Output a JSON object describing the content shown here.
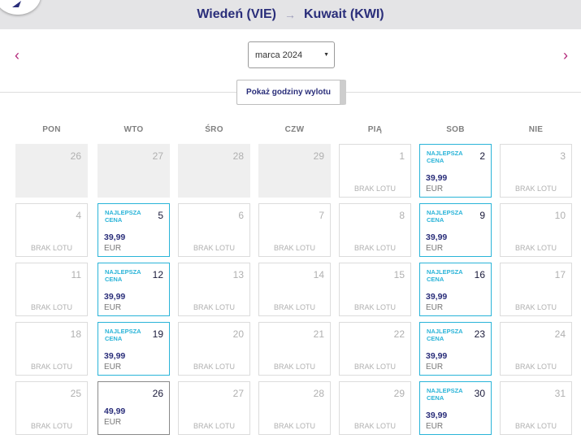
{
  "header": {
    "origin": "Wiedeń (VIE)",
    "arrow": "→",
    "destination": "Kuwait (KWI)"
  },
  "nav": {
    "prev_icon": "‹",
    "next_icon": "›"
  },
  "month_select": {
    "value": "marca 2024"
  },
  "show_times_button": "Pokaż godziny wylotu",
  "colors": {
    "brand": "#2a2e7a",
    "accent": "#b3287a",
    "best": "#2ab4d8"
  },
  "calendar": {
    "weekdays": [
      "PON",
      "WTO",
      "ŚRO",
      "CZW",
      "PIĄ",
      "SOB",
      "NIE"
    ],
    "no_flight_label": "BRAK LOTU",
    "best_label": "NAJLEPSZA CENA",
    "currency": "EUR",
    "days": [
      {
        "day": "26",
        "state": "disabled"
      },
      {
        "day": "27",
        "state": "disabled"
      },
      {
        "day": "28",
        "state": "disabled"
      },
      {
        "day": "29",
        "state": "disabled"
      },
      {
        "day": "1",
        "state": "none"
      },
      {
        "day": "2",
        "state": "best",
        "price": "39,99"
      },
      {
        "day": "3",
        "state": "none"
      },
      {
        "day": "4",
        "state": "none"
      },
      {
        "day": "5",
        "state": "best",
        "price": "39,99"
      },
      {
        "day": "6",
        "state": "none"
      },
      {
        "day": "7",
        "state": "none"
      },
      {
        "day": "8",
        "state": "none"
      },
      {
        "day": "9",
        "state": "best",
        "price": "39,99"
      },
      {
        "day": "10",
        "state": "none"
      },
      {
        "day": "11",
        "state": "none"
      },
      {
        "day": "12",
        "state": "best",
        "price": "39,99"
      },
      {
        "day": "13",
        "state": "none"
      },
      {
        "day": "14",
        "state": "none"
      },
      {
        "day": "15",
        "state": "none"
      },
      {
        "day": "16",
        "state": "best",
        "price": "39,99"
      },
      {
        "day": "17",
        "state": "none"
      },
      {
        "day": "18",
        "state": "none"
      },
      {
        "day": "19",
        "state": "best",
        "price": "39,99"
      },
      {
        "day": "20",
        "state": "none"
      },
      {
        "day": "21",
        "state": "none"
      },
      {
        "day": "22",
        "state": "none"
      },
      {
        "day": "23",
        "state": "best",
        "price": "39,99"
      },
      {
        "day": "24",
        "state": "none"
      },
      {
        "day": "25",
        "state": "none"
      },
      {
        "day": "26",
        "state": "priced",
        "price": "49,99"
      },
      {
        "day": "27",
        "state": "none"
      },
      {
        "day": "28",
        "state": "none"
      },
      {
        "day": "29",
        "state": "none"
      },
      {
        "day": "30",
        "state": "best",
        "price": "39,99"
      },
      {
        "day": "31",
        "state": "none"
      }
    ]
  }
}
